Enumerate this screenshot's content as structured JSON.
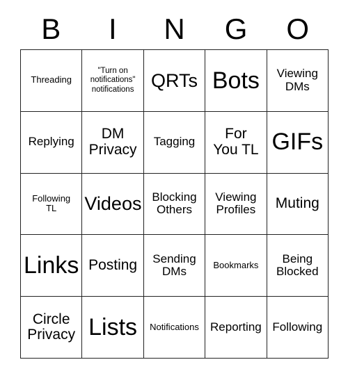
{
  "card": {
    "title": "BINGO",
    "header_letters": [
      "B",
      "I",
      "N",
      "G",
      "O"
    ],
    "colors": {
      "background": "#ffffff",
      "text": "#000000",
      "grid_line": "#222222"
    },
    "columns": 5,
    "rows": 5,
    "cells": [
      {
        "label": "Threading",
        "size": "sm"
      },
      {
        "label": "\"Turn on\nnotifications\"\nnotifications",
        "size": "xs"
      },
      {
        "label": "QRTs",
        "size": "xl"
      },
      {
        "label": "Bots",
        "size": "xxl"
      },
      {
        "label": "Viewing\nDMs",
        "size": "md"
      },
      {
        "label": "Replying",
        "size": "md"
      },
      {
        "label": "DM\nPrivacy",
        "size": "lg"
      },
      {
        "label": "Tagging",
        "size": "md"
      },
      {
        "label": "For\nYou TL",
        "size": "lg"
      },
      {
        "label": "GIFs",
        "size": "xxl"
      },
      {
        "label": "Following\nTL",
        "size": "sm"
      },
      {
        "label": "Videos",
        "size": "xl"
      },
      {
        "label": "Blocking\nOthers",
        "size": "md"
      },
      {
        "label": "Viewing\nProfiles",
        "size": "md"
      },
      {
        "label": "Muting",
        "size": "lg"
      },
      {
        "label": "Links",
        "size": "xxl"
      },
      {
        "label": "Posting",
        "size": "lg"
      },
      {
        "label": "Sending\nDMs",
        "size": "md"
      },
      {
        "label": "Bookmarks",
        "size": "sm"
      },
      {
        "label": "Being\nBlocked",
        "size": "md"
      },
      {
        "label": "Circle\nPrivacy",
        "size": "lg"
      },
      {
        "label": "Lists",
        "size": "xxl"
      },
      {
        "label": "Notifications",
        "size": "sm"
      },
      {
        "label": "Reporting",
        "size": "md"
      },
      {
        "label": "Following",
        "size": "md"
      }
    ]
  }
}
